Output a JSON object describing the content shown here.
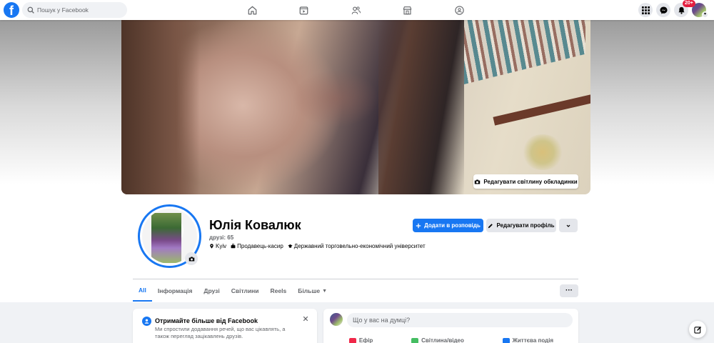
{
  "topbar": {
    "logo": "f",
    "search_placeholder": "Пошук у Facebook",
    "nav_icons": [
      "home-icon",
      "watch-icon",
      "friends-icon",
      "marketplace-icon",
      "groups-icon"
    ],
    "notifications_badge": "20+"
  },
  "cover": {
    "edit_button": "Редагувати світлину обкладинки"
  },
  "profile": {
    "name": "Юлія Ковалюк",
    "friends": "друзі: 65",
    "location": "Kyiv",
    "job": "Продавець-касир",
    "education": "Державний торговельно-економічний університет"
  },
  "actions": {
    "add_story": "Додати в розповідь",
    "edit_profile": "Редагувати профіль"
  },
  "tabs": [
    {
      "label": "All",
      "active": true
    },
    {
      "label": "Інформація",
      "active": false
    },
    {
      "label": "Друзі",
      "active": false
    },
    {
      "label": "Світлини",
      "active": false
    },
    {
      "label": "Reels",
      "active": false
    },
    {
      "label": "Більше",
      "active": false
    }
  ],
  "suggest_card": {
    "title": "Отримайте більше від Facebook",
    "description": "Ми спростили додавання речей, що вас цікавлять, а також перегляд зацікавлень друзів."
  },
  "composer": {
    "placeholder": "Що у вас на думці?",
    "actions": [
      "Ефір",
      "Світлина/відео",
      "Життєва подія"
    ]
  },
  "colors": {
    "accent": "#1877f2",
    "background": "#f0f2f5",
    "badge": "#e41e3f"
  }
}
